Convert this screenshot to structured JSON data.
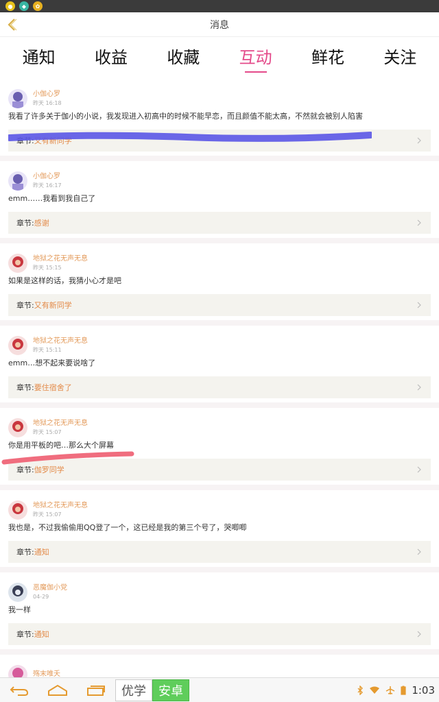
{
  "header": {
    "title": "消息"
  },
  "tabs": [
    {
      "label": "通知",
      "active": false
    },
    {
      "label": "收益",
      "active": false
    },
    {
      "label": "收藏",
      "active": false
    },
    {
      "label": "互动",
      "active": true
    },
    {
      "label": "鲜花",
      "active": false
    },
    {
      "label": "关注",
      "active": false
    }
  ],
  "chapter_label": "章节:",
  "messages": [
    {
      "user": "小伽心罗",
      "time": "昨天 16:18",
      "text": "我看了许多关于伽小的小说，我发现进入初高中的时候不能早恋，而且颜值不能太高，不然就会被别人陷害",
      "chapter": "又有新同学"
    },
    {
      "user": "小伽心罗",
      "time": "昨天 16:17",
      "text": "emm……我看到我自己了",
      "chapter": "感谢"
    },
    {
      "user": "地狱之花无声无息",
      "time": "昨天 15:15",
      "text": "如果是这样的话，我猜小心才是吧",
      "chapter": "又有新同学"
    },
    {
      "user": "地狱之花无声无息",
      "time": "昨天 15:11",
      "text": "emm…想不起来要说啥了",
      "chapter": "要住宿舍了"
    },
    {
      "user": "地狱之花无声无息",
      "time": "昨天 15:07",
      "text": "你是用平板的吧…那么大个屏幕",
      "chapter": "伽罗同学"
    },
    {
      "user": "地狱之花无声无息",
      "time": "昨天 15:07",
      "text": "我也是，不过我偷偷用QQ登了一个，这已经是我的第三个号了，哭唧唧",
      "chapter": "通知"
    },
    {
      "user": "恶魔伽小党",
      "time": "04-29",
      "text": "我一样",
      "chapter": "通知"
    },
    {
      "user": "殇末唯夭"
    }
  ],
  "navbar": {
    "app1": "优学",
    "app2": "安卓",
    "clock": "1:03"
  },
  "colors": {
    "accent": "#e44a8a",
    "username": "#e39a5a",
    "chapter": "#e38b4a"
  }
}
